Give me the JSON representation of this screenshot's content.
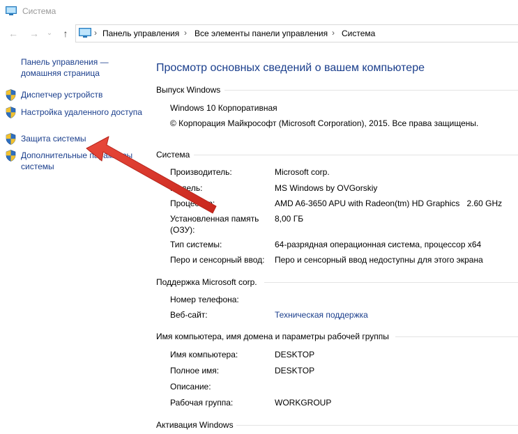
{
  "window": {
    "title": "Система"
  },
  "address": {
    "crumbs": [
      "Панель управления",
      "Все элементы панели управления",
      "Система"
    ],
    "separator": "›"
  },
  "nav": {
    "back": "←",
    "forward": "→",
    "dropdown": "⌄",
    "up": "↑"
  },
  "sidebar": {
    "home_link": "Панель управления — домашняя страница",
    "items": [
      {
        "label": "Диспетчер устройств",
        "icon": "shield-icon"
      },
      {
        "label": "Настройка удаленного доступа",
        "icon": "shield-icon"
      },
      {
        "label": "Защита системы",
        "icon": "shield-icon"
      },
      {
        "label": "Дополнительные параметры системы",
        "icon": "shield-icon"
      }
    ]
  },
  "main": {
    "title": "Просмотр основных сведений о вашем компьютере",
    "edition": {
      "heading": "Выпуск Windows",
      "name": "Windows 10 Корпоративная",
      "copyright": "© Корпорация Майкрософт (Microsoft Corporation), 2015. Все права защищены."
    },
    "system": {
      "heading": "Система",
      "rows": [
        {
          "key": "Производитель:",
          "value": "Microsoft corp."
        },
        {
          "key": "Модель:",
          "value": "MS Windows by OVGorskiy"
        },
        {
          "key": "Процессор:",
          "value": "AMD A6-3650 APU with Radeon(tm) HD Graphics   2.60 GHz"
        },
        {
          "key": "Установленная память (ОЗУ):",
          "value": "8,00 ГБ"
        },
        {
          "key": "Тип системы:",
          "value": "64-разрядная операционная система, процессор x64"
        },
        {
          "key": "Перо и сенсорный ввод:",
          "value": "Перо и сенсорный ввод недоступны для этого экрана"
        }
      ]
    },
    "support": {
      "heading": "Поддержка Microsoft corp.",
      "rows": [
        {
          "key": "Номер телефона:",
          "value": ""
        },
        {
          "key": "Веб-сайт:",
          "value": "Техническая поддержка"
        }
      ]
    },
    "computer": {
      "heading": "Имя компьютера, имя домена и параметры рабочей группы",
      "rows": [
        {
          "key": "Имя компьютера:",
          "value": "DESKTOP"
        },
        {
          "key": "Полное имя:",
          "value": "DESKTOP"
        },
        {
          "key": "Описание:",
          "value": ""
        },
        {
          "key": "Рабочая группа:",
          "value": "WORKGROUP"
        }
      ]
    },
    "activation": {
      "heading": "Активация Windows"
    }
  },
  "colors": {
    "link": "#1a3e8c",
    "annotation_arrow": "#e0352b",
    "rule": "#e3e3e3"
  }
}
